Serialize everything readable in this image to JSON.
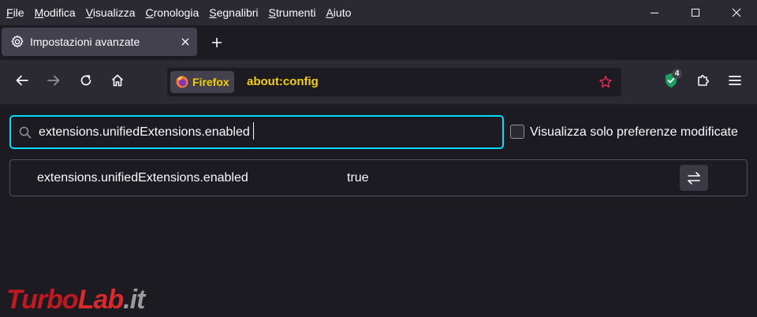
{
  "menubar": {
    "items": [
      {
        "label": "File",
        "accel": "F",
        "rest": "ile"
      },
      {
        "label": "Modifica",
        "accel": "M",
        "rest": "odifica"
      },
      {
        "label": "Visualizza",
        "accel": "V",
        "rest": "isualizza"
      },
      {
        "label": "Cronologia",
        "accel": "C",
        "rest": "ronologia"
      },
      {
        "label": "Segnalibri",
        "accel": "S",
        "rest": "egnalibri"
      },
      {
        "label": "Strumenti",
        "accel": "S",
        "rest": "trumenti"
      },
      {
        "label": "Aiuto",
        "accel": "A",
        "rest": "iuto"
      }
    ],
    "window_controls": [
      "minimize-icon",
      "maximize-icon",
      "close-icon"
    ]
  },
  "tabs": [
    {
      "title": "Impostazioni avanzate",
      "icon": "gear-icon",
      "active": true
    }
  ],
  "navbar": {
    "identity_label": "Firefox",
    "url": "about:config",
    "extension_badge": "4"
  },
  "config": {
    "search_value": "extensions.unifiedExtensions.enabled",
    "show_modified_label": "Visualizza solo preferenze modificate",
    "show_modified_checked": false,
    "preferences": [
      {
        "name": "extensions.unifiedExtensions.enabled",
        "value": "true"
      }
    ]
  },
  "watermark": {
    "part1": "Turbo",
    "part2": "Lab",
    "part3": ".it"
  },
  "colors": {
    "accent_focus": "#00ddff",
    "url_text": "#f5d000",
    "toolbar_bg": "#2b2a33",
    "content_bg": "#1c1b22",
    "bookmark_star": "#e22850"
  }
}
